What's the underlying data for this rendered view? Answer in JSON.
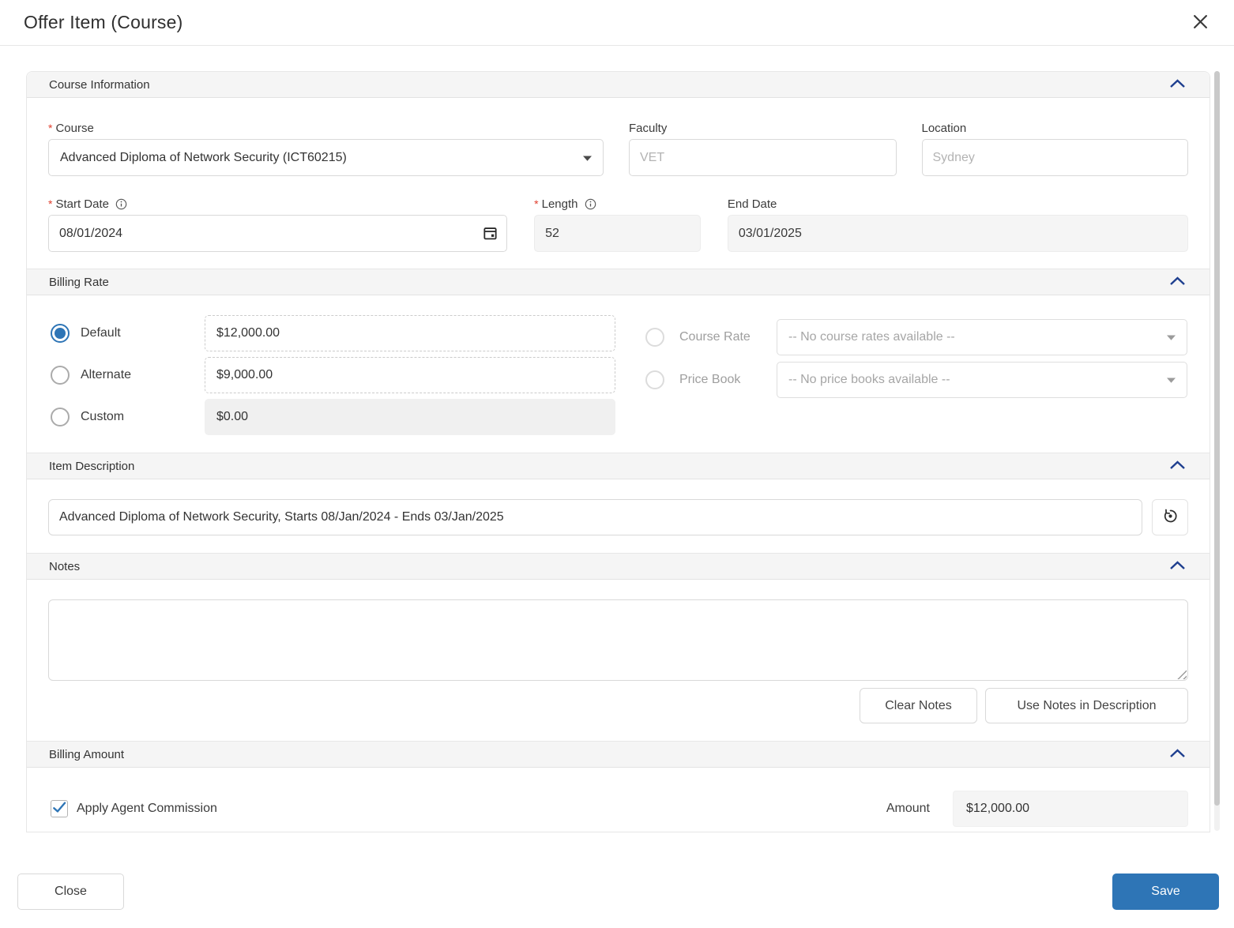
{
  "modal": {
    "title": "Offer Item (Course)"
  },
  "ui": {
    "required_marker": "*"
  },
  "icons": {
    "close": "x-cross",
    "collapse": "chevron-up",
    "info": "i-in-circle",
    "calendar": "calendar-grid",
    "dropdown": "caret-down",
    "reset": "restore-circular-arrow",
    "check": "checkmark",
    "resize": "diagonal-grip"
  },
  "colors": {
    "accent_blue": "#2e75b6",
    "chevron_navy": "#1e3f8f",
    "required_red": "#e03e2d",
    "section_header_bg": "#f5f5f5",
    "disabled_bg": "#f5f5f5",
    "border_gray": "#d9d9d9"
  },
  "course_information": {
    "section_title": "Course Information",
    "course_label": "Course",
    "course_value": "Advanced Diploma of Network Security (ICT60215)",
    "faculty_label": "Faculty",
    "faculty_value": "VET",
    "location_label": "Location",
    "location_value": "Sydney",
    "start_date_label": "Start Date",
    "start_date_value": "08/01/2024",
    "length_label": "Length",
    "length_value": "52",
    "end_date_label": "End Date",
    "end_date_value": "03/01/2025"
  },
  "billing_rate": {
    "section_title": "Billing Rate",
    "selected_option": "Default",
    "options": [
      {
        "label": "Default",
        "value": "$12,000.00"
      },
      {
        "label": "Alternate",
        "value": "$9,000.00"
      },
      {
        "label": "Custom",
        "value": "$0.00"
      }
    ],
    "course_rate_label": "Course Rate",
    "course_rate_placeholder": "-- No course rates available --",
    "price_book_label": "Price Book",
    "price_book_placeholder": "-- No price books available --"
  },
  "item_description": {
    "section_title": "Item Description",
    "value": "Advanced Diploma of Network Security, Starts 08/Jan/2024 - Ends 03/Jan/2025"
  },
  "notes": {
    "section_title": "Notes",
    "value": "",
    "clear_notes_label": "Clear Notes",
    "use_notes_label": "Use Notes in Description"
  },
  "billing_amount": {
    "section_title": "Billing Amount",
    "apply_agent_commission_label": "Apply Agent Commission",
    "amount_label": "Amount",
    "amount_value": "$12,000.00"
  },
  "footer": {
    "close_label": "Close",
    "save_label": "Save"
  }
}
